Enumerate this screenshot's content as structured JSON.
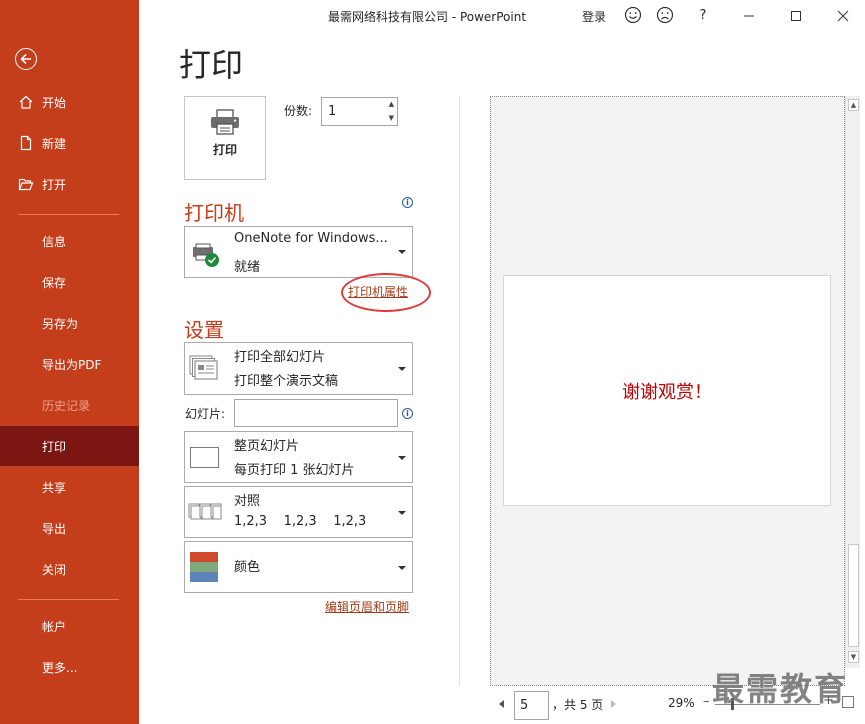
{
  "window": {
    "title": "最需网络科技有限公司  -  PowerPoint",
    "login": "登录",
    "help": "?"
  },
  "sidebar": {
    "items": [
      {
        "label": "开始"
      },
      {
        "label": "新建"
      },
      {
        "label": "打开"
      },
      {
        "label": "信息"
      },
      {
        "label": "保存"
      },
      {
        "label": "另存为"
      },
      {
        "label": "导出为PDF"
      },
      {
        "label": "历史记录"
      },
      {
        "label": "打印"
      },
      {
        "label": "共享"
      },
      {
        "label": "导出"
      },
      {
        "label": "关闭"
      },
      {
        "label": "帐户"
      },
      {
        "label": "更多..."
      }
    ],
    "active": "打印"
  },
  "main": {
    "title": "打印",
    "print_button": "打印",
    "copies_label": "份数:",
    "copies_value": "1",
    "printer_heading": "打印机",
    "printer": {
      "name": "OneNote for Windows...",
      "status": "就绪"
    },
    "printer_properties_link": "打印机属性",
    "settings_heading": "设置",
    "range": {
      "line1": "打印全部幻灯片",
      "line2": "打印整个演示文稿"
    },
    "slides_label": "幻灯片:",
    "slides_value": "",
    "layout": {
      "line1": "整页幻灯片",
      "line2": "每页打印 1 张幻灯片"
    },
    "collate": {
      "line1": "对照",
      "line2": "1,2,3    1,2,3    1,2,3"
    },
    "color": {
      "line1": "颜色"
    },
    "header_footer_link": "编辑页眉和页脚"
  },
  "preview": {
    "slide_text": "谢谢观赏！",
    "current_page": "5",
    "total_pages": "，共 5 页",
    "zoom": "29%"
  },
  "watermark": "最需教育",
  "colors": {
    "sidebar": "#C43E1C",
    "sidebar_active": "#7C1613",
    "heading": "#C43E1C",
    "slide_text": "#C00000"
  }
}
